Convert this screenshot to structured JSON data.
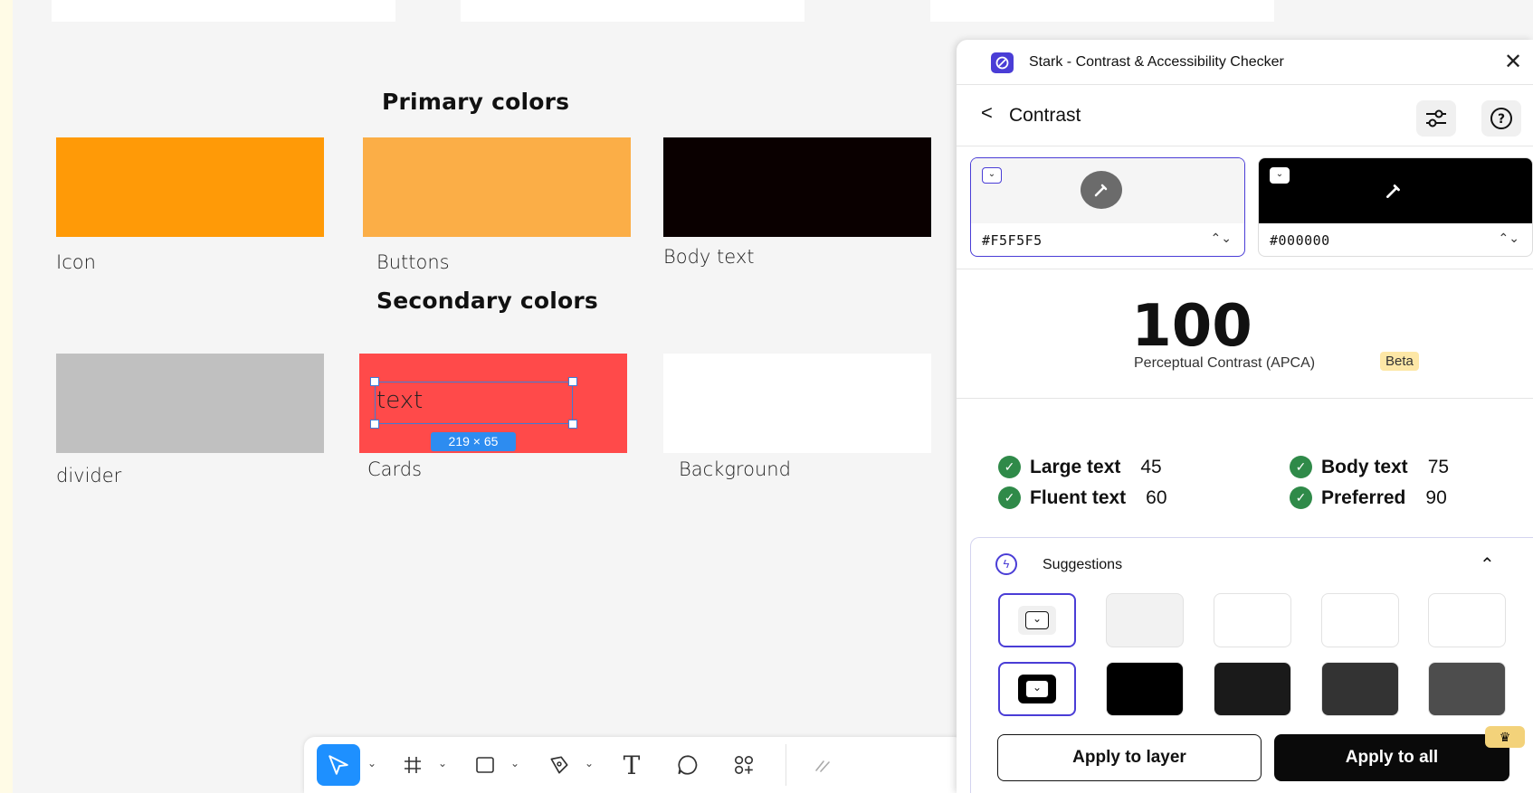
{
  "canvas": {
    "headings": {
      "primary": "Primary colors",
      "secondary": "Secondary colors"
    },
    "primary_swatches": [
      {
        "label": "Icon",
        "color": "#ff9a07"
      },
      {
        "label": "Buttons",
        "color": "#fbae47"
      },
      {
        "label": "Body text",
        "color": "#0a0000"
      }
    ],
    "secondary_swatches": [
      {
        "label": "divider",
        "color": "#c0c0c0"
      },
      {
        "label": "Cards",
        "color": "#ff4a4a"
      },
      {
        "label": "Background",
        "color": "#ffffff"
      }
    ],
    "selection": {
      "text": "text",
      "size_badge": "219 × 65"
    }
  },
  "toolbar": {
    "tools": [
      {
        "name": "move-tool",
        "icon": "pointer-icon",
        "active": true
      },
      {
        "name": "frame-tool",
        "icon": "hash-icon"
      },
      {
        "name": "shape-tool",
        "icon": "square-icon"
      },
      {
        "name": "pen-tool",
        "icon": "pen-icon"
      },
      {
        "name": "text-tool",
        "icon": "text-icon",
        "glyph": "T"
      },
      {
        "name": "comment-tool",
        "icon": "comment-icon"
      },
      {
        "name": "actions-tool",
        "icon": "components-icon"
      }
    ]
  },
  "plugin": {
    "title": "Stark - Contrast & Accessibility Checker",
    "close_glyph": "✕",
    "section": "Contrast",
    "back_glyph": "<",
    "foreground": {
      "hex": "#F5F5F5",
      "color": "#f5f5f5"
    },
    "background": {
      "hex": "#000000",
      "color": "#000000"
    },
    "score": "100",
    "score_label": "Perceptual Contrast (APCA)",
    "beta": "Beta",
    "checks": [
      {
        "label": "Large text",
        "value": "45"
      },
      {
        "label": "Body text",
        "value": "75"
      },
      {
        "label": "Fluent text",
        "value": "60"
      },
      {
        "label": "Preferred",
        "value": "90"
      }
    ],
    "suggestions_title": "Suggestions",
    "suggestion_rows": [
      [
        "#f5f5f5",
        "#f2f2f2",
        "#ffffff",
        "#ffffff",
        "#ffffff"
      ],
      [
        "#000000",
        "#000000",
        "#1a1a1a",
        "#333333",
        "#4d4d4d"
      ]
    ],
    "apply_layer": "Apply to layer",
    "apply_all": "Apply to all",
    "accent": "#4a3dd6"
  }
}
